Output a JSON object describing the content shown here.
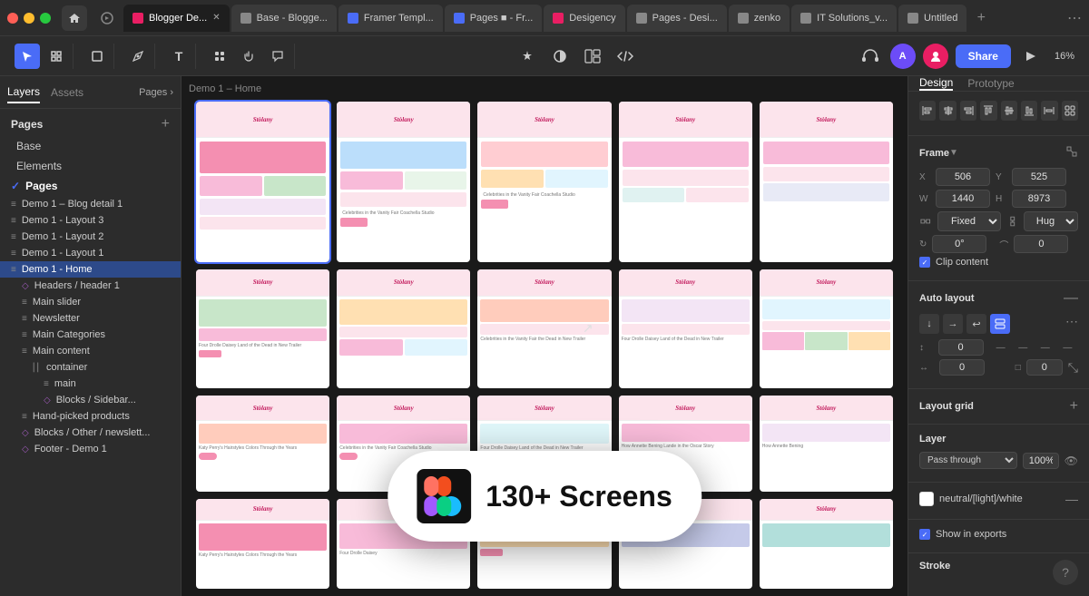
{
  "topbar": {
    "tabs": [
      {
        "id": "t1",
        "label": "Blogger De...",
        "color": "#e91e63",
        "active": true
      },
      {
        "id": "t2",
        "label": "Base - Blogge...",
        "color": "#888",
        "active": false
      },
      {
        "id": "t3",
        "label": "Framer Templ...",
        "color": "#4a6cf7",
        "active": false
      },
      {
        "id": "t4",
        "label": "Pages ■ - Fr...",
        "color": "#4a6cf7",
        "active": false
      },
      {
        "id": "t5",
        "label": "Desigency",
        "color": "#e91e63",
        "active": false
      },
      {
        "id": "t6",
        "label": "Pages - Desi...",
        "color": "#888",
        "active": false
      },
      {
        "id": "t7",
        "label": "zenko",
        "color": "#888",
        "active": false
      },
      {
        "id": "t8",
        "label": "IT Solutions_v...",
        "color": "#888",
        "active": false
      },
      {
        "id": "t9",
        "label": "Untitled",
        "color": "#888",
        "active": false
      }
    ]
  },
  "toolbar": {
    "tools": [
      {
        "id": "select",
        "icon": "↖",
        "active": true
      },
      {
        "id": "frame",
        "icon": "⊞"
      },
      {
        "id": "shape",
        "icon": "□"
      },
      {
        "id": "pen",
        "icon": "✒"
      },
      {
        "id": "text",
        "icon": "T"
      },
      {
        "id": "components",
        "icon": "⊕"
      },
      {
        "id": "hand",
        "icon": "✋"
      },
      {
        "id": "comment",
        "icon": "💬"
      }
    ],
    "share_label": "Share",
    "zoom_level": "16%"
  },
  "left_panel": {
    "tabs": [
      {
        "id": "layers",
        "label": "Layers",
        "active": true
      },
      {
        "id": "assets",
        "label": "Assets",
        "active": false
      }
    ],
    "pages_label": "Pages ›",
    "pages_section_title": "Pages",
    "pages": [
      {
        "id": "base",
        "label": "Base",
        "indent": 0
      },
      {
        "id": "elements",
        "label": "Elements",
        "indent": 0
      },
      {
        "id": "pages",
        "label": "Pages",
        "indent": 0,
        "active": true,
        "checked": true
      }
    ],
    "layers": [
      {
        "id": "blog-detail",
        "label": "Demo 1 – Blog detail 1",
        "icon": "≡",
        "indent": 1
      },
      {
        "id": "layout3",
        "label": "Demo 1 - Layout 3",
        "icon": "≡",
        "indent": 1
      },
      {
        "id": "layout2",
        "label": "Demo 1 - Layout 2",
        "icon": "≡",
        "indent": 1
      },
      {
        "id": "layout1",
        "label": "Demo 1 - Layout 1",
        "icon": "≡",
        "indent": 1
      },
      {
        "id": "home",
        "label": "Demo 1 - Home",
        "icon": "≡",
        "indent": 1,
        "active": true
      },
      {
        "id": "headers",
        "label": "Headers / header 1",
        "icon": "◇",
        "indent": 2,
        "diamond": true
      },
      {
        "id": "main-slider",
        "label": "Main slider",
        "icon": "≡",
        "indent": 2
      },
      {
        "id": "newsletter",
        "label": "Newsletter",
        "icon": "≡",
        "indent": 2
      },
      {
        "id": "main-categories",
        "label": "Main Categories",
        "icon": "≡",
        "indent": 2
      },
      {
        "id": "main-content",
        "label": "Main content",
        "icon": "≡",
        "indent": 2
      },
      {
        "id": "container",
        "label": "container",
        "icon": "⎜⎜",
        "indent": 3
      },
      {
        "id": "main",
        "label": "main",
        "icon": "≡",
        "indent": 4
      },
      {
        "id": "blocks-sidebar",
        "label": "Blocks / Sidebar...",
        "icon": "◇",
        "indent": 4,
        "diamond": true
      },
      {
        "id": "hand-picked",
        "label": "Hand-picked products",
        "icon": "≡",
        "indent": 2
      },
      {
        "id": "blocks-newsletter",
        "label": "Blocks / Other / newslett...",
        "icon": "◇",
        "indent": 2,
        "diamond": true
      },
      {
        "id": "footer",
        "label": "Footer - Demo 1",
        "icon": "◇",
        "indent": 2,
        "diamond": true
      }
    ]
  },
  "canvas": {
    "label": "Demo 1 – Home",
    "badge_text": "130+ Screens"
  },
  "right_panel": {
    "tabs": [
      {
        "id": "design",
        "label": "Design",
        "active": true
      },
      {
        "id": "prototype",
        "label": "Prototype",
        "active": false
      }
    ],
    "frame_section": {
      "title": "Frame",
      "x": "506",
      "y": "525",
      "w": "1440",
      "h": "8973",
      "constraint_w": "Fixed",
      "constraint_h": "Hug",
      "rotation": "0°",
      "corner": "0"
    },
    "clip_content": {
      "label": "Clip content",
      "checked": true
    },
    "auto_layout": {
      "title": "Auto layout",
      "gap_v": "0",
      "gap_h": "0",
      "padding_icon": "—"
    },
    "layout_grid": {
      "title": "Layout grid"
    },
    "layer": {
      "title": "Layer",
      "mode": "Pass through",
      "opacity": "100%"
    },
    "fill": {
      "title": "neutral/[light]/white",
      "color": "#ffffff"
    },
    "show_in_exports": {
      "label": "Show in exports",
      "checked": true
    },
    "stroke": {
      "title": "Stroke"
    }
  }
}
